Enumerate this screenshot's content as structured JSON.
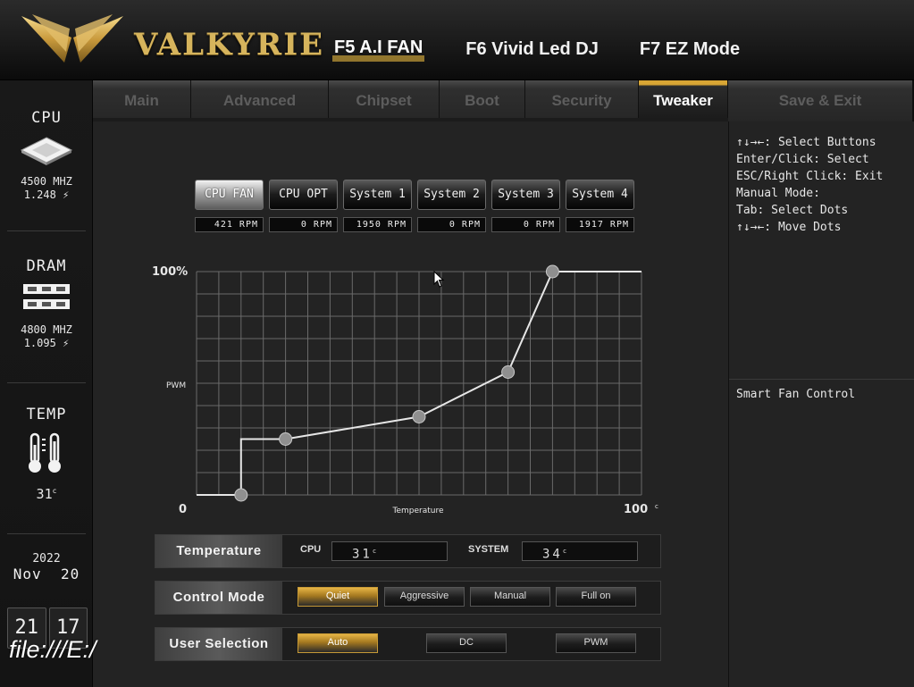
{
  "header": {
    "brand": "VALKYRIE",
    "hotkeys": [
      "F5 A.I FAN",
      "F6 Vivid Led DJ",
      "F7 EZ Mode"
    ]
  },
  "tabs": [
    "Main",
    "Advanced",
    "Chipset",
    "Boot",
    "Security",
    "Tweaker",
    "Save & Exit"
  ],
  "active_tab": "Tweaker",
  "left": {
    "cpu": {
      "label": "CPU",
      "freq": "4500 MHZ",
      "volt": "1.248"
    },
    "dram": {
      "label": "DRAM",
      "freq": "4800 MHZ",
      "volt": "1.095"
    },
    "temp": {
      "label": "TEMP",
      "value": "31",
      "unit": "c"
    },
    "date": {
      "year": "2022",
      "day": "Nov  20"
    },
    "clock": {
      "hh": "21",
      "mm": "17"
    }
  },
  "fans": {
    "tabs": [
      "CPU FAN",
      "CPU OPT",
      "System 1",
      "System 2",
      "System 3",
      "System 4"
    ],
    "rpm": [
      "421 RPM",
      "0 RPM",
      "1950 RPM",
      "0 RPM",
      "0 RPM",
      "1917 RPM"
    ],
    "active": 0
  },
  "chart_data": {
    "type": "line",
    "x": [
      0,
      10,
      20,
      50,
      70,
      80,
      100
    ],
    "y": [
      0,
      0,
      25,
      35,
      55,
      100,
      100
    ],
    "curve_points_x": [
      10,
      20,
      50,
      70,
      80
    ],
    "curve_points_y": [
      0,
      25,
      35,
      55,
      100
    ],
    "title": "",
    "xlabel": "Temperature",
    "ylabel": "PWM",
    "x_min_label": "0",
    "x_max_label": "100",
    "x_unit": "c",
    "y_max_label": "100%",
    "xlim": [
      0,
      100
    ],
    "ylim": [
      0,
      100
    ],
    "grid": true
  },
  "temperature_panel": {
    "label": "Temperature",
    "cpu_label": "CPU",
    "cpu_value": "31",
    "system_label": "SYSTEM",
    "system_value": "34",
    "unit": "c"
  },
  "control_mode": {
    "label": "Control Mode",
    "options": [
      "Quiet",
      "Aggressive",
      "Manual",
      "Full on"
    ],
    "active": 0
  },
  "user_selection": {
    "label": "User Selection",
    "options": [
      "Auto",
      "DC",
      "PWM"
    ],
    "active": 0
  },
  "help": {
    "lines": [
      "↑↓→←: Select Buttons",
      "Enter/Click: Select",
      "ESC/Right Click: Exit",
      "Manual Mode:",
      "Tab: Select Dots",
      "↑↓→←: Move Dots"
    ],
    "description": "Smart Fan Control"
  },
  "overlay": {
    "file_url": "file:///E:/"
  },
  "colors": {
    "accent": "#d9a634",
    "background": "#232323"
  }
}
